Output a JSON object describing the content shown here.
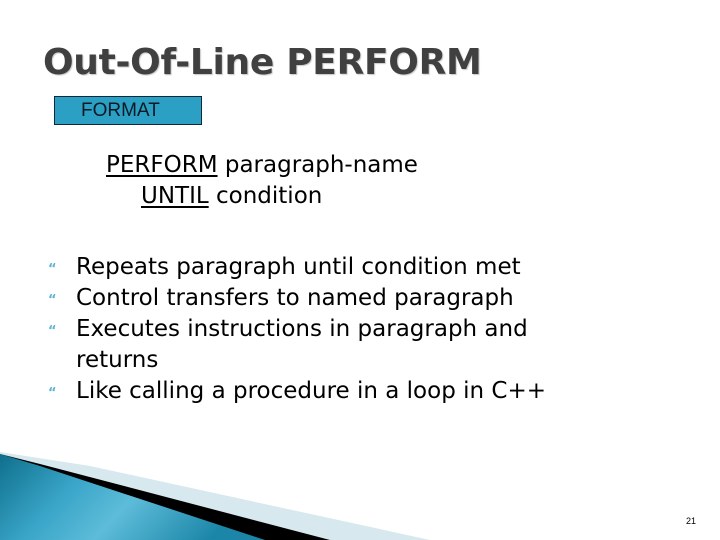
{
  "slide": {
    "title": "Out-Of-Line PERFORM",
    "format_label": "FORMAT",
    "syntax": {
      "line1_keyword": "PERFORM",
      "line1_rest": " paragraph-name",
      "line2_keyword": "UNTIL",
      "line2_rest": " condition"
    },
    "bullets": [
      {
        "icon": "quote-bullet-icon",
        "text": "Repeats paragraph until condition met"
      },
      {
        "icon": "quote-bullet-icon",
        "text": "Control transfers to named paragraph"
      },
      {
        "icon": "quote-bullet-icon",
        "text": "Executes instructions in paragraph and returns"
      },
      {
        "icon": "quote-bullet-icon",
        "text": "Like calling a procedure in a loop in C++"
      }
    ],
    "page_number": "21",
    "colors": {
      "accent": "#2c9fc4",
      "title": "#404040",
      "bullet": "#5fb4cf"
    }
  }
}
